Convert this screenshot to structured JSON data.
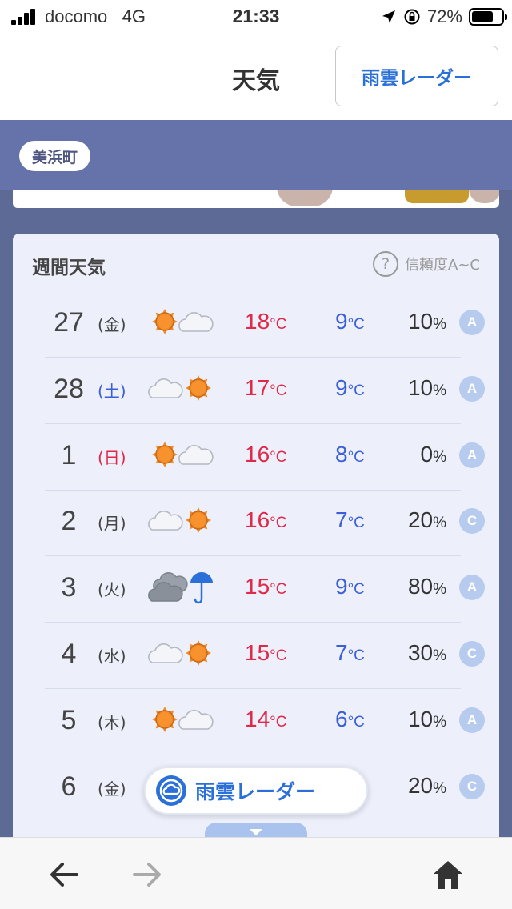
{
  "status": {
    "carrier": "docomo",
    "network": "4G",
    "time": "21:33",
    "battery": "72%",
    "battery_level": 0.72
  },
  "header": {
    "title": "天気",
    "radar_button": "雨雲レーダー"
  },
  "location": {
    "name": "美浜町"
  },
  "weekly": {
    "title": "週間天気",
    "reliability_label": "信頼度A~C",
    "unit_temp": "°C",
    "unit_pop": "%",
    "rows": [
      {
        "day": "27",
        "dow": "(金)",
        "icon": "sunny-then-cloudy-icon",
        "hi": "18",
        "lo": "9",
        "pop": "10",
        "grade": "A"
      },
      {
        "day": "28",
        "dow": "(土)",
        "icon": "cloudy-then-sunny-icon",
        "hi": "17",
        "lo": "9",
        "pop": "10",
        "grade": "A"
      },
      {
        "day": "1",
        "dow": "(日)",
        "icon": "sunny-then-cloudy-icon",
        "hi": "16",
        "lo": "8",
        "pop": "0",
        "grade": "A"
      },
      {
        "day": "2",
        "dow": "(月)",
        "icon": "cloudy-then-sunny-icon",
        "hi": "16",
        "lo": "7",
        "pop": "20",
        "grade": "C"
      },
      {
        "day": "3",
        "dow": "(火)",
        "icon": "cloudy-then-rain-icon",
        "hi": "15",
        "lo": "9",
        "pop": "80",
        "grade": "A"
      },
      {
        "day": "4",
        "dow": "(水)",
        "icon": "cloudy-then-sunny-icon",
        "hi": "15",
        "lo": "7",
        "pop": "30",
        "grade": "C"
      },
      {
        "day": "5",
        "dow": "(木)",
        "icon": "sunny-then-cloudy-icon",
        "hi": "14",
        "lo": "6",
        "pop": "10",
        "grade": "A"
      },
      {
        "day": "6",
        "dow": "(金)",
        "icon": "",
        "hi": "",
        "lo": "",
        "pop": "20",
        "grade": "C"
      }
    ]
  },
  "floating_radar": {
    "label": "雨雲レーダー"
  },
  "colors": {
    "accent": "#2a70d8",
    "hi_temp": "#e02848",
    "lo_temp": "#3a5fd6",
    "banner": "#6673aa"
  }
}
